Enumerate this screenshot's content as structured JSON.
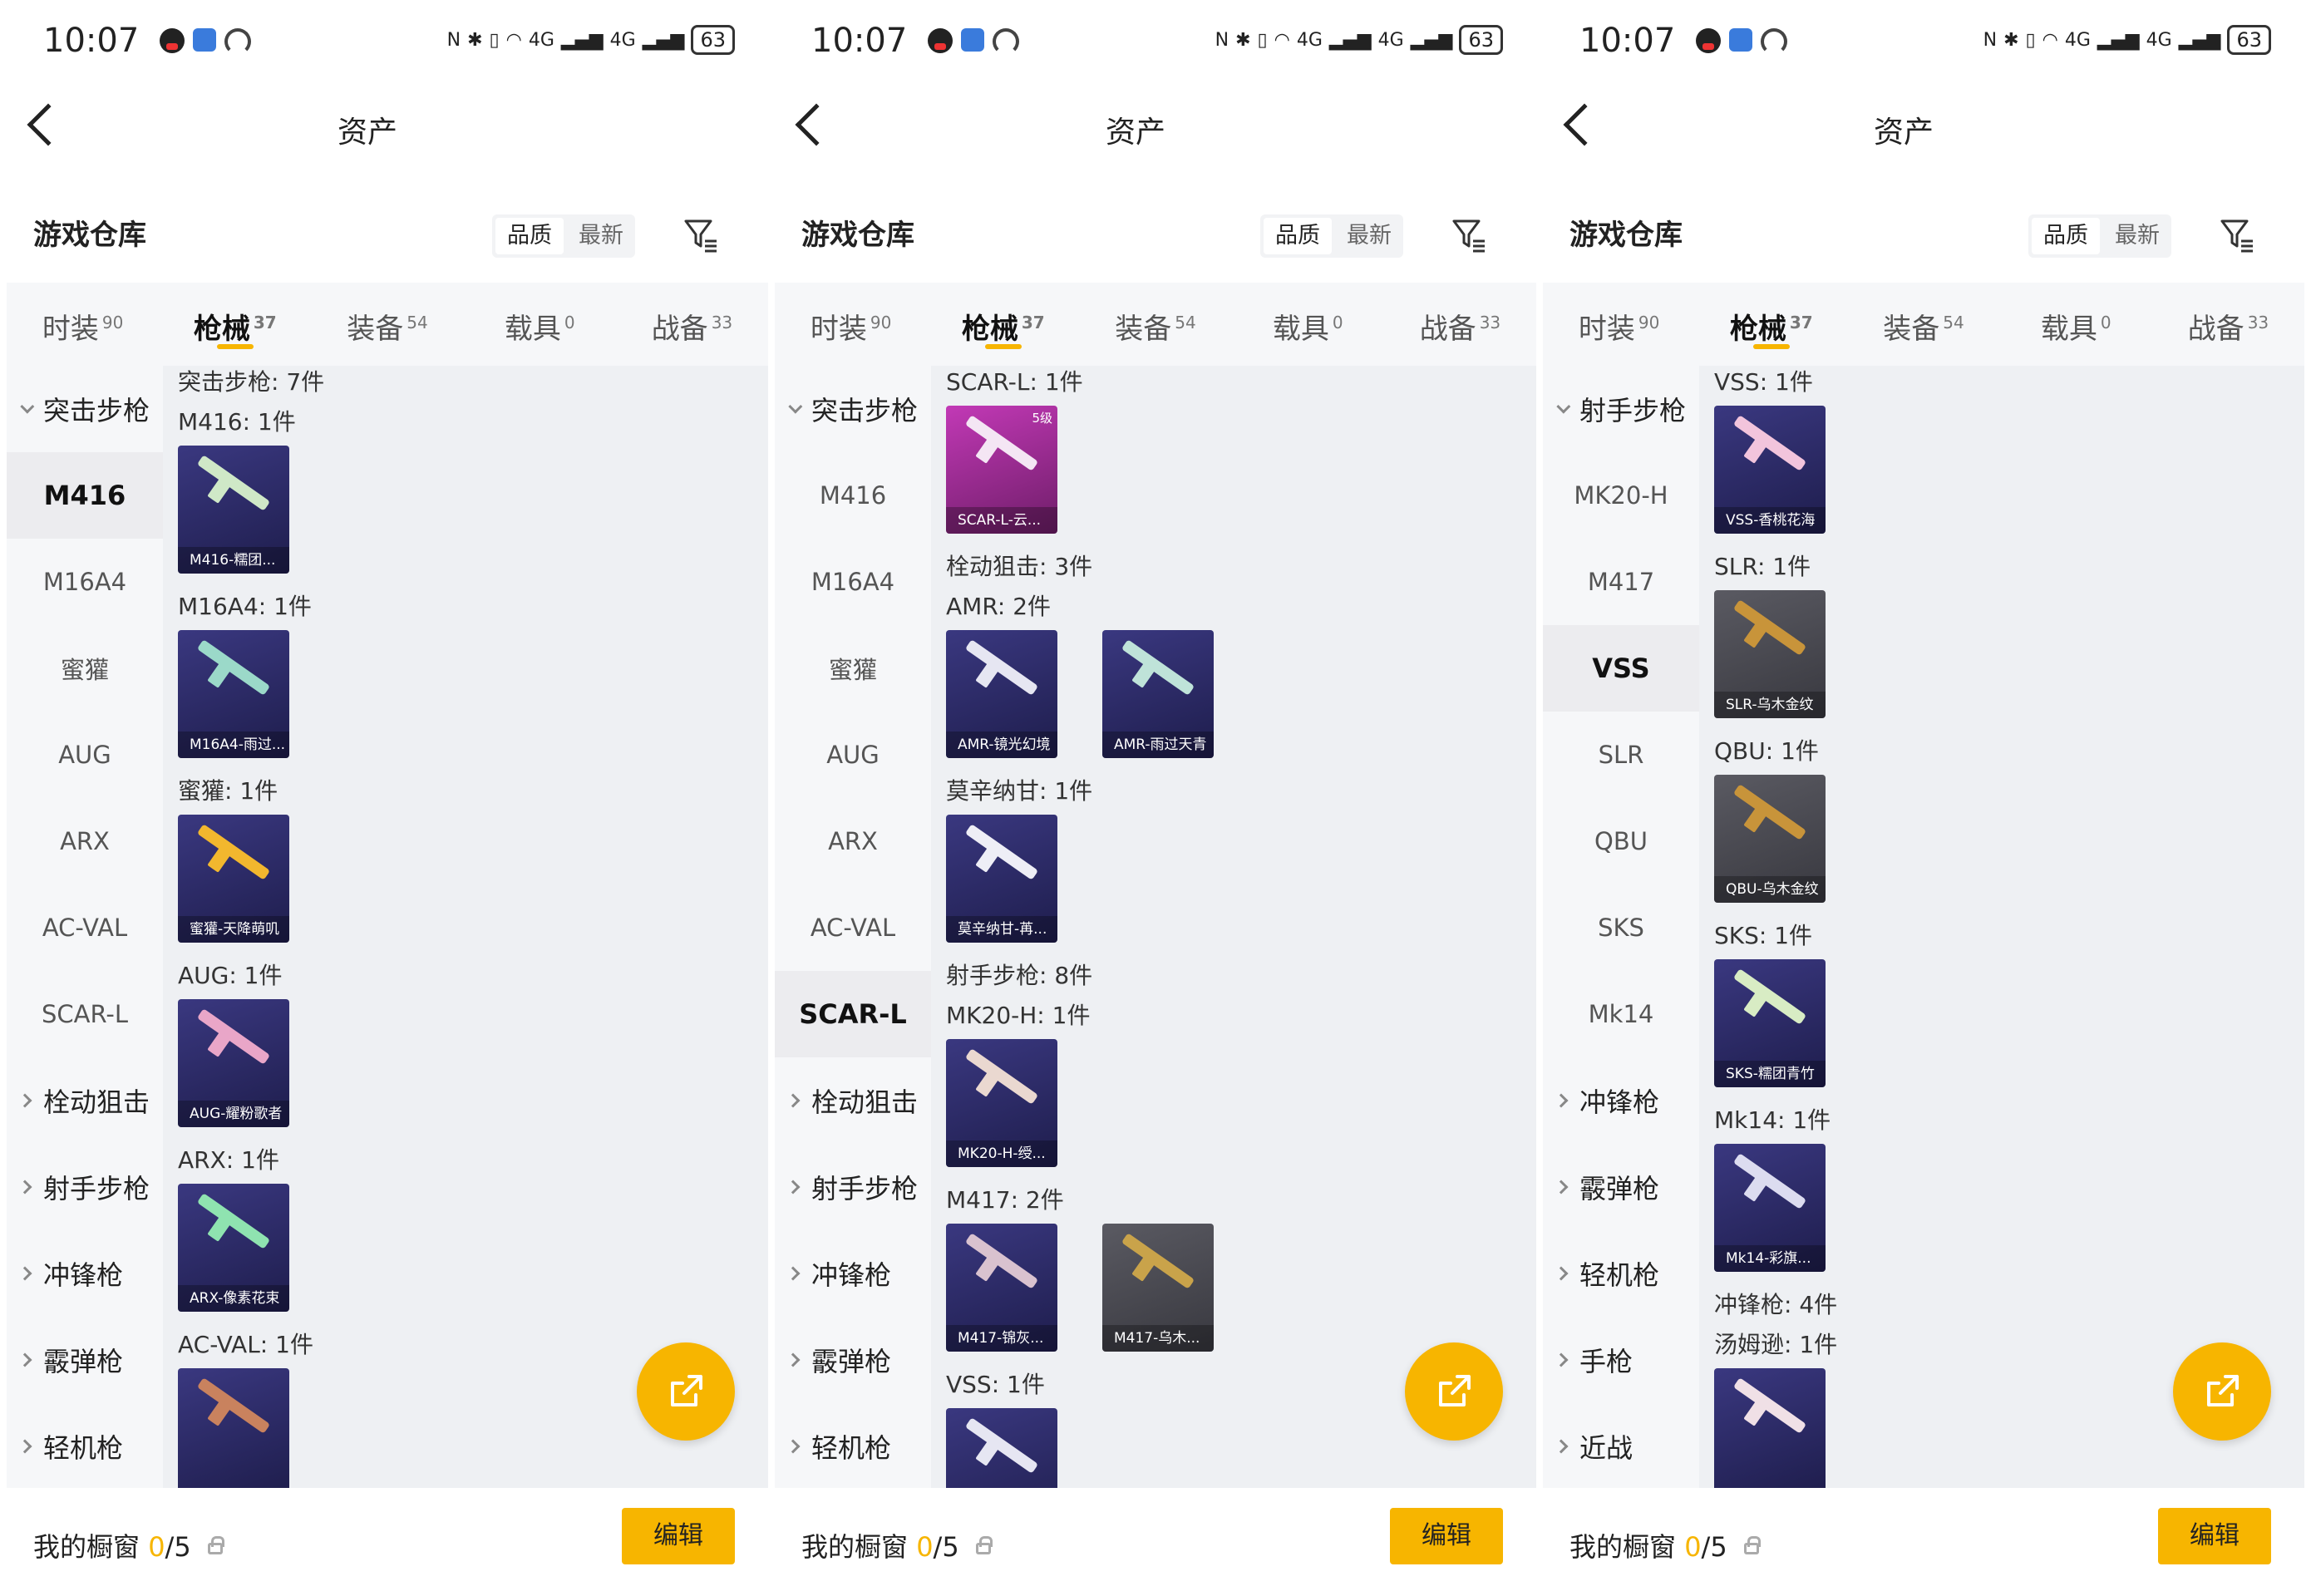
{
  "accent_color": "#f7b500",
  "panels": [
    {
      "status": {
        "time": "10:07",
        "net": "4G",
        "battery": "63"
      },
      "title": "资产",
      "warehouse_title": "游戏仓库",
      "sort_options": [
        "品质",
        "最新"
      ],
      "tabs": [
        {
          "label": "时装",
          "count": "90"
        },
        {
          "label": "枪械",
          "count": "37"
        },
        {
          "label": "装备",
          "count": "54"
        },
        {
          "label": "载具",
          "count": "0"
        },
        {
          "label": "战备",
          "count": "33"
        }
      ],
      "active_tab": 1,
      "sidebar": [
        {
          "kind": "group",
          "label": "突击步枪",
          "expanded": true
        },
        {
          "kind": "item",
          "label": "M416",
          "selected": true
        },
        {
          "kind": "item",
          "label": "M16A4"
        },
        {
          "kind": "item",
          "label": "蜜獾"
        },
        {
          "kind": "item",
          "label": "AUG"
        },
        {
          "kind": "item",
          "label": "ARX"
        },
        {
          "kind": "item",
          "label": "AC-VAL"
        },
        {
          "kind": "item",
          "label": "SCAR-L"
        },
        {
          "kind": "group",
          "label": "栓动狙击"
        },
        {
          "kind": "group",
          "label": "射手步枪"
        },
        {
          "kind": "group",
          "label": "冲锋枪"
        },
        {
          "kind": "group",
          "label": "霰弹枪"
        },
        {
          "kind": "group",
          "label": "轻机枪"
        }
      ],
      "content": [
        {
          "title": "突击步枪: 7件",
          "items": []
        },
        {
          "title": "M416: 1件",
          "items": [
            {
              "caption": "M416-糯团...",
              "style": "blue",
              "gun": "#cfe8c7"
            }
          ]
        },
        {
          "title": "M16A4: 1件",
          "items": [
            {
              "caption": "M16A4-雨过...",
              "style": "blue",
              "gun": "#9bd9c9"
            }
          ]
        },
        {
          "title": "蜜獾: 1件",
          "items": [
            {
              "caption": "蜜獾-天降萌叽",
              "style": "blue",
              "gun": "#f2b72e"
            }
          ]
        },
        {
          "title": "AUG: 1件",
          "items": [
            {
              "caption": "AUG-耀粉歌者",
              "style": "blue",
              "gun": "#e9a6c8"
            }
          ]
        },
        {
          "title": "ARX: 1件",
          "items": [
            {
              "caption": "ARX-像素花束",
              "style": "blue",
              "gun": "#8fe3b0"
            }
          ]
        },
        {
          "title": "AC-VAL: 1件",
          "items": [
            {
              "caption": "",
              "style": "blue",
              "gun": "#c9825e"
            }
          ]
        }
      ],
      "bottom": {
        "label": "我的橱窗",
        "count": "0",
        "total": "/5",
        "edit": "编辑"
      }
    },
    {
      "status": {
        "time": "10:07",
        "net": "4G",
        "battery": "63"
      },
      "title": "资产",
      "warehouse_title": "游戏仓库",
      "sort_options": [
        "品质",
        "最新"
      ],
      "tabs": [
        {
          "label": "时装",
          "count": "90"
        },
        {
          "label": "枪械",
          "count": "37"
        },
        {
          "label": "装备",
          "count": "54"
        },
        {
          "label": "载具",
          "count": "0"
        },
        {
          "label": "战备",
          "count": "33"
        }
      ],
      "active_tab": 1,
      "sidebar": [
        {
          "kind": "group",
          "label": "突击步枪",
          "expanded": true
        },
        {
          "kind": "item",
          "label": "M416"
        },
        {
          "kind": "item",
          "label": "M16A4"
        },
        {
          "kind": "item",
          "label": "蜜獾"
        },
        {
          "kind": "item",
          "label": "AUG"
        },
        {
          "kind": "item",
          "label": "ARX"
        },
        {
          "kind": "item",
          "label": "AC-VAL"
        },
        {
          "kind": "item",
          "label": "SCAR-L",
          "selected": true
        },
        {
          "kind": "group",
          "label": "栓动狙击"
        },
        {
          "kind": "group",
          "label": "射手步枪"
        },
        {
          "kind": "group",
          "label": "冲锋枪"
        },
        {
          "kind": "group",
          "label": "霰弹枪"
        },
        {
          "kind": "group",
          "label": "轻机枪"
        }
      ],
      "content": [
        {
          "title": "SCAR-L: 1件",
          "items": [
            {
              "caption": "SCAR-L-云...",
              "style": "pink",
              "gun": "#f4e6f4",
              "level": "5级"
            }
          ]
        },
        {
          "title": "栓动狙击: 3件",
          "items": []
        },
        {
          "title": "AMR: 2件",
          "items": [
            {
              "caption": "AMR-镜光幻境",
              "style": "blue",
              "gun": "#e6e6f2"
            },
            {
              "caption": "AMR-雨过天青",
              "style": "blue",
              "gun": "#bfe3d9"
            }
          ]
        },
        {
          "title": "莫辛纳甘: 1件",
          "items": [
            {
              "caption": "莫辛纳甘-苒...",
              "style": "blue",
              "gun": "#eeeef6"
            }
          ]
        },
        {
          "title": "射手步枪: 8件",
          "items": []
        },
        {
          "title": "MK20-H: 1件",
          "items": [
            {
              "caption": "MK20-H-绶...",
              "style": "blue",
              "gun": "#ead8d0"
            }
          ]
        },
        {
          "title": "M417: 2件",
          "items": [
            {
              "caption": "M417-锦灰...",
              "style": "blue",
              "gun": "#d9c2cf"
            },
            {
              "caption": "M417-乌木...",
              "style": "grey",
              "gun": "#c9a34a"
            }
          ]
        },
        {
          "title": "VSS: 1件",
          "items": [
            {
              "caption": "",
              "style": "blue",
              "gun": "#e6e6f2"
            }
          ]
        }
      ],
      "bottom": {
        "label": "我的橱窗",
        "count": "0",
        "total": "/5",
        "edit": "编辑"
      }
    },
    {
      "status": {
        "time": "10:07",
        "net": "4G",
        "battery": "63"
      },
      "title": "资产",
      "warehouse_title": "游戏仓库",
      "sort_options": [
        "品质",
        "最新"
      ],
      "tabs": [
        {
          "label": "时装",
          "count": "90"
        },
        {
          "label": "枪械",
          "count": "37"
        },
        {
          "label": "装备",
          "count": "54"
        },
        {
          "label": "载具",
          "count": "0"
        },
        {
          "label": "战备",
          "count": "33"
        }
      ],
      "active_tab": 1,
      "sidebar": [
        {
          "kind": "group",
          "label": "射手步枪",
          "expanded": true
        },
        {
          "kind": "item",
          "label": "MK20-H"
        },
        {
          "kind": "item",
          "label": "M417"
        },
        {
          "kind": "item",
          "label": "VSS",
          "selected": true
        },
        {
          "kind": "item",
          "label": "SLR"
        },
        {
          "kind": "item",
          "label": "QBU"
        },
        {
          "kind": "item",
          "label": "SKS"
        },
        {
          "kind": "item",
          "label": "Mk14"
        },
        {
          "kind": "group",
          "label": "冲锋枪"
        },
        {
          "kind": "group",
          "label": "霰弹枪"
        },
        {
          "kind": "group",
          "label": "轻机枪"
        },
        {
          "kind": "group",
          "label": "手枪"
        },
        {
          "kind": "group",
          "label": "近战"
        }
      ],
      "content": [
        {
          "title": "VSS: 1件",
          "items": [
            {
              "caption": "VSS-香桃花海",
              "style": "blue",
              "gun": "#f2c4dc"
            }
          ]
        },
        {
          "title": "SLR: 1件",
          "items": [
            {
              "caption": "SLR-乌木金纹",
              "style": "grey",
              "gun": "#c8943a"
            }
          ]
        },
        {
          "title": "QBU: 1件",
          "items": [
            {
              "caption": "QBU-乌木金纹",
              "style": "grey",
              "gun": "#c8943a"
            }
          ]
        },
        {
          "title": "SKS: 1件",
          "items": [
            {
              "caption": "SKS-糯团青竹",
              "style": "blue",
              "gun": "#d8ecc4"
            }
          ]
        },
        {
          "title": "Mk14: 1件",
          "items": [
            {
              "caption": "Mk14-彩旗...",
              "style": "blue",
              "gun": "#dcdcf0"
            }
          ]
        },
        {
          "title": "冲锋枪: 4件",
          "items": []
        },
        {
          "title": "汤姆逊: 1件",
          "items": [
            {
              "caption": "",
              "style": "blue",
              "gun": "#f0e0e6"
            }
          ]
        }
      ],
      "bottom": {
        "label": "我的橱窗",
        "count": "0",
        "total": "/5",
        "edit": "编辑"
      }
    }
  ]
}
